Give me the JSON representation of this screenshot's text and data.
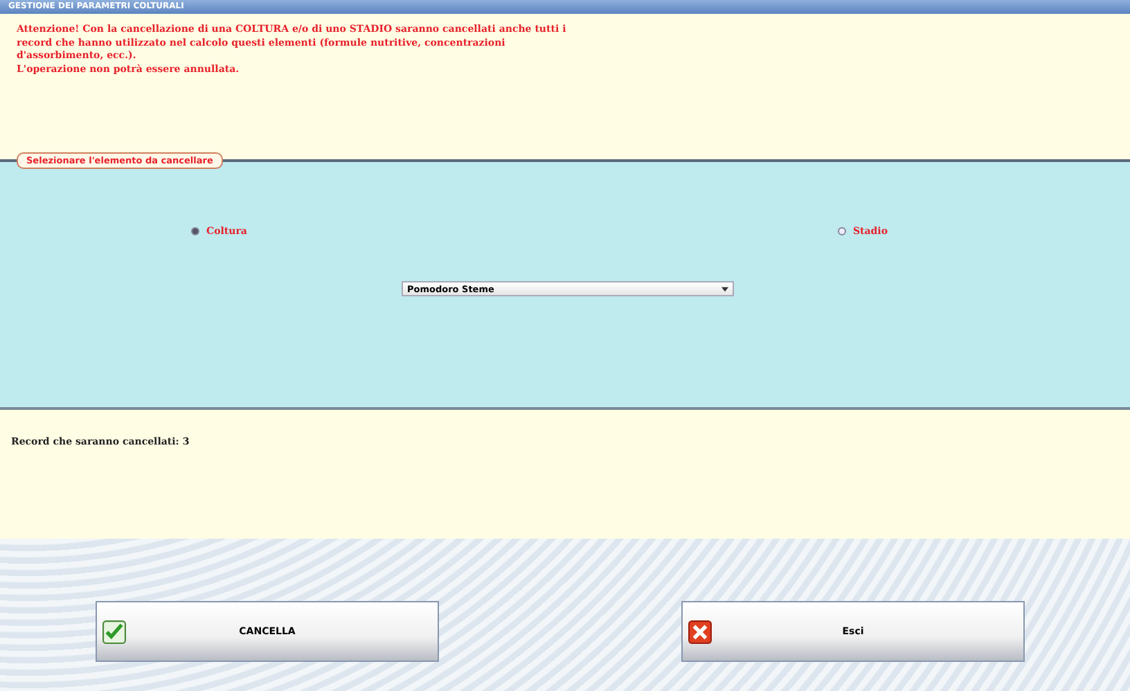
{
  "window": {
    "title": "GESTIONE DEI PARAMETRI COLTURALI"
  },
  "warning": {
    "lines": [
      "Attenzione! Con la cancellazione di una COLTURA e/o di uno STADIO saranno cancellati anche tutti i",
      "record che hanno utilizzato nel calcolo questi elementi (formule nutritive, concentrazioni",
      "d'assorbimento, ecc.).",
      "L'operazione non potrà essere annullata."
    ]
  },
  "group": {
    "title": "Selezionare l'elemento da cancellare",
    "options": [
      {
        "label": "Coltura",
        "selected": true
      },
      {
        "label": "Stadio",
        "selected": false
      }
    ],
    "dropdown": {
      "value": "Pomodoro Steme"
    }
  },
  "records": {
    "text": "Record che saranno cancellati: 3"
  },
  "buttons": [
    {
      "label": "CANCELLA",
      "kind": "confirm"
    },
    {
      "label": "Esci",
      "kind": "exit"
    }
  ]
}
